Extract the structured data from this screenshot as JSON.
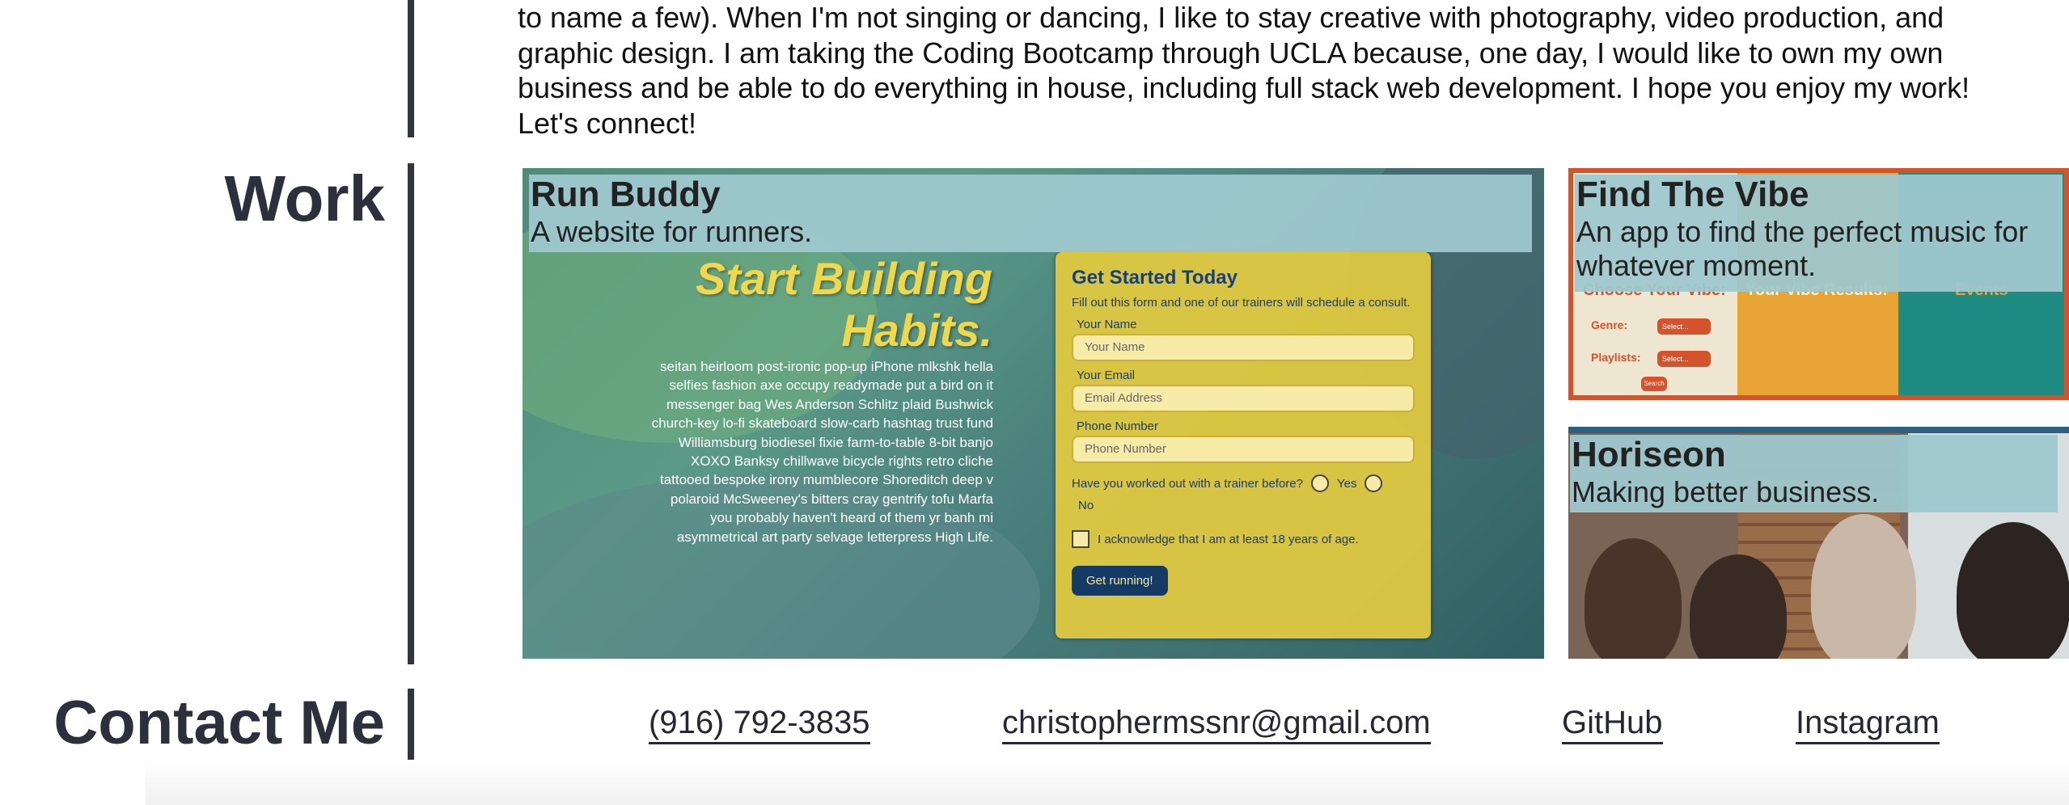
{
  "about": {
    "lines": [
      "to name a few). When I'm not singing or dancing, I like to stay creative with photography, video production, and",
      "graphic design. I am taking the Coding Bootcamp through UCLA because, one day, I would like to own my own",
      "business and be able to do everything in house, including full stack web development. I hope you enjoy my work!",
      "Let's connect!"
    ]
  },
  "work": {
    "heading": "Work",
    "projects": [
      {
        "title": "Run Buddy",
        "description": "A website for runners.",
        "preview": {
          "headline_line1": "Start Building",
          "headline_line2": "Habits.",
          "lorem": "seitan heirloom post-ironic pop-up iPhone mlkshk hella selfies fashion axe occupy readymade put a bird on it messenger bag Wes Anderson Schlitz plaid Bushwick church-key lo-fi skateboard slow-carb hashtag trust fund Williamsburg biodiesel fixie farm-to-table 8-bit banjo XOXO Banksy chillwave bicycle rights retro cliche tattooed bespoke irony mumblecore Shoreditch deep v polaroid McSweeney's bitters cray gentrify tofu Marfa you probably haven't heard of them yr banh mi asymmetrical art party selvage letterpress High Life.",
          "form": {
            "title": "Get Started Today",
            "subtitle": "Fill out this form and one of our trainers will schedule a consult.",
            "name_label": "Your Name",
            "name_placeholder": "Your Name",
            "email_label": "Your Email",
            "email_placeholder": "Email Address",
            "phone_label": "Phone Number",
            "phone_placeholder": "Phone Number",
            "trainer_question": "Have you worked out with a trainer before?",
            "yes_label": "Yes",
            "no_label": "No",
            "ack_label": "I acknowledge that I am at least 18 years of age.",
            "submit_label": "Get running!"
          }
        }
      },
      {
        "title": "Find The Vibe",
        "description": "An app to find the perfect music for whatever moment.",
        "preview": {
          "col1_heading": "Choose Your Vibe:",
          "genre_label": "Genre:",
          "playlists_label": "Playlists:",
          "select_label": "Select...",
          "search_label": "Search",
          "col2_heading": "Your Vibe Results:",
          "col3_heading": "Events"
        }
      },
      {
        "title": "Horiseon",
        "description": "Making better business."
      }
    ]
  },
  "contact": {
    "heading": "Contact Me",
    "phone": "(916) 792-3835",
    "email": "christophermssnr@gmail.com",
    "github": "GitHub",
    "instagram": "Instagram"
  },
  "colors": {
    "section_bar": "#32353f",
    "caption_bg": "#9ec8cd",
    "runbuddy_yellow": "#e2ca3e",
    "runbuddy_navy": "#163a66",
    "ftv_border": "#d4532a"
  }
}
